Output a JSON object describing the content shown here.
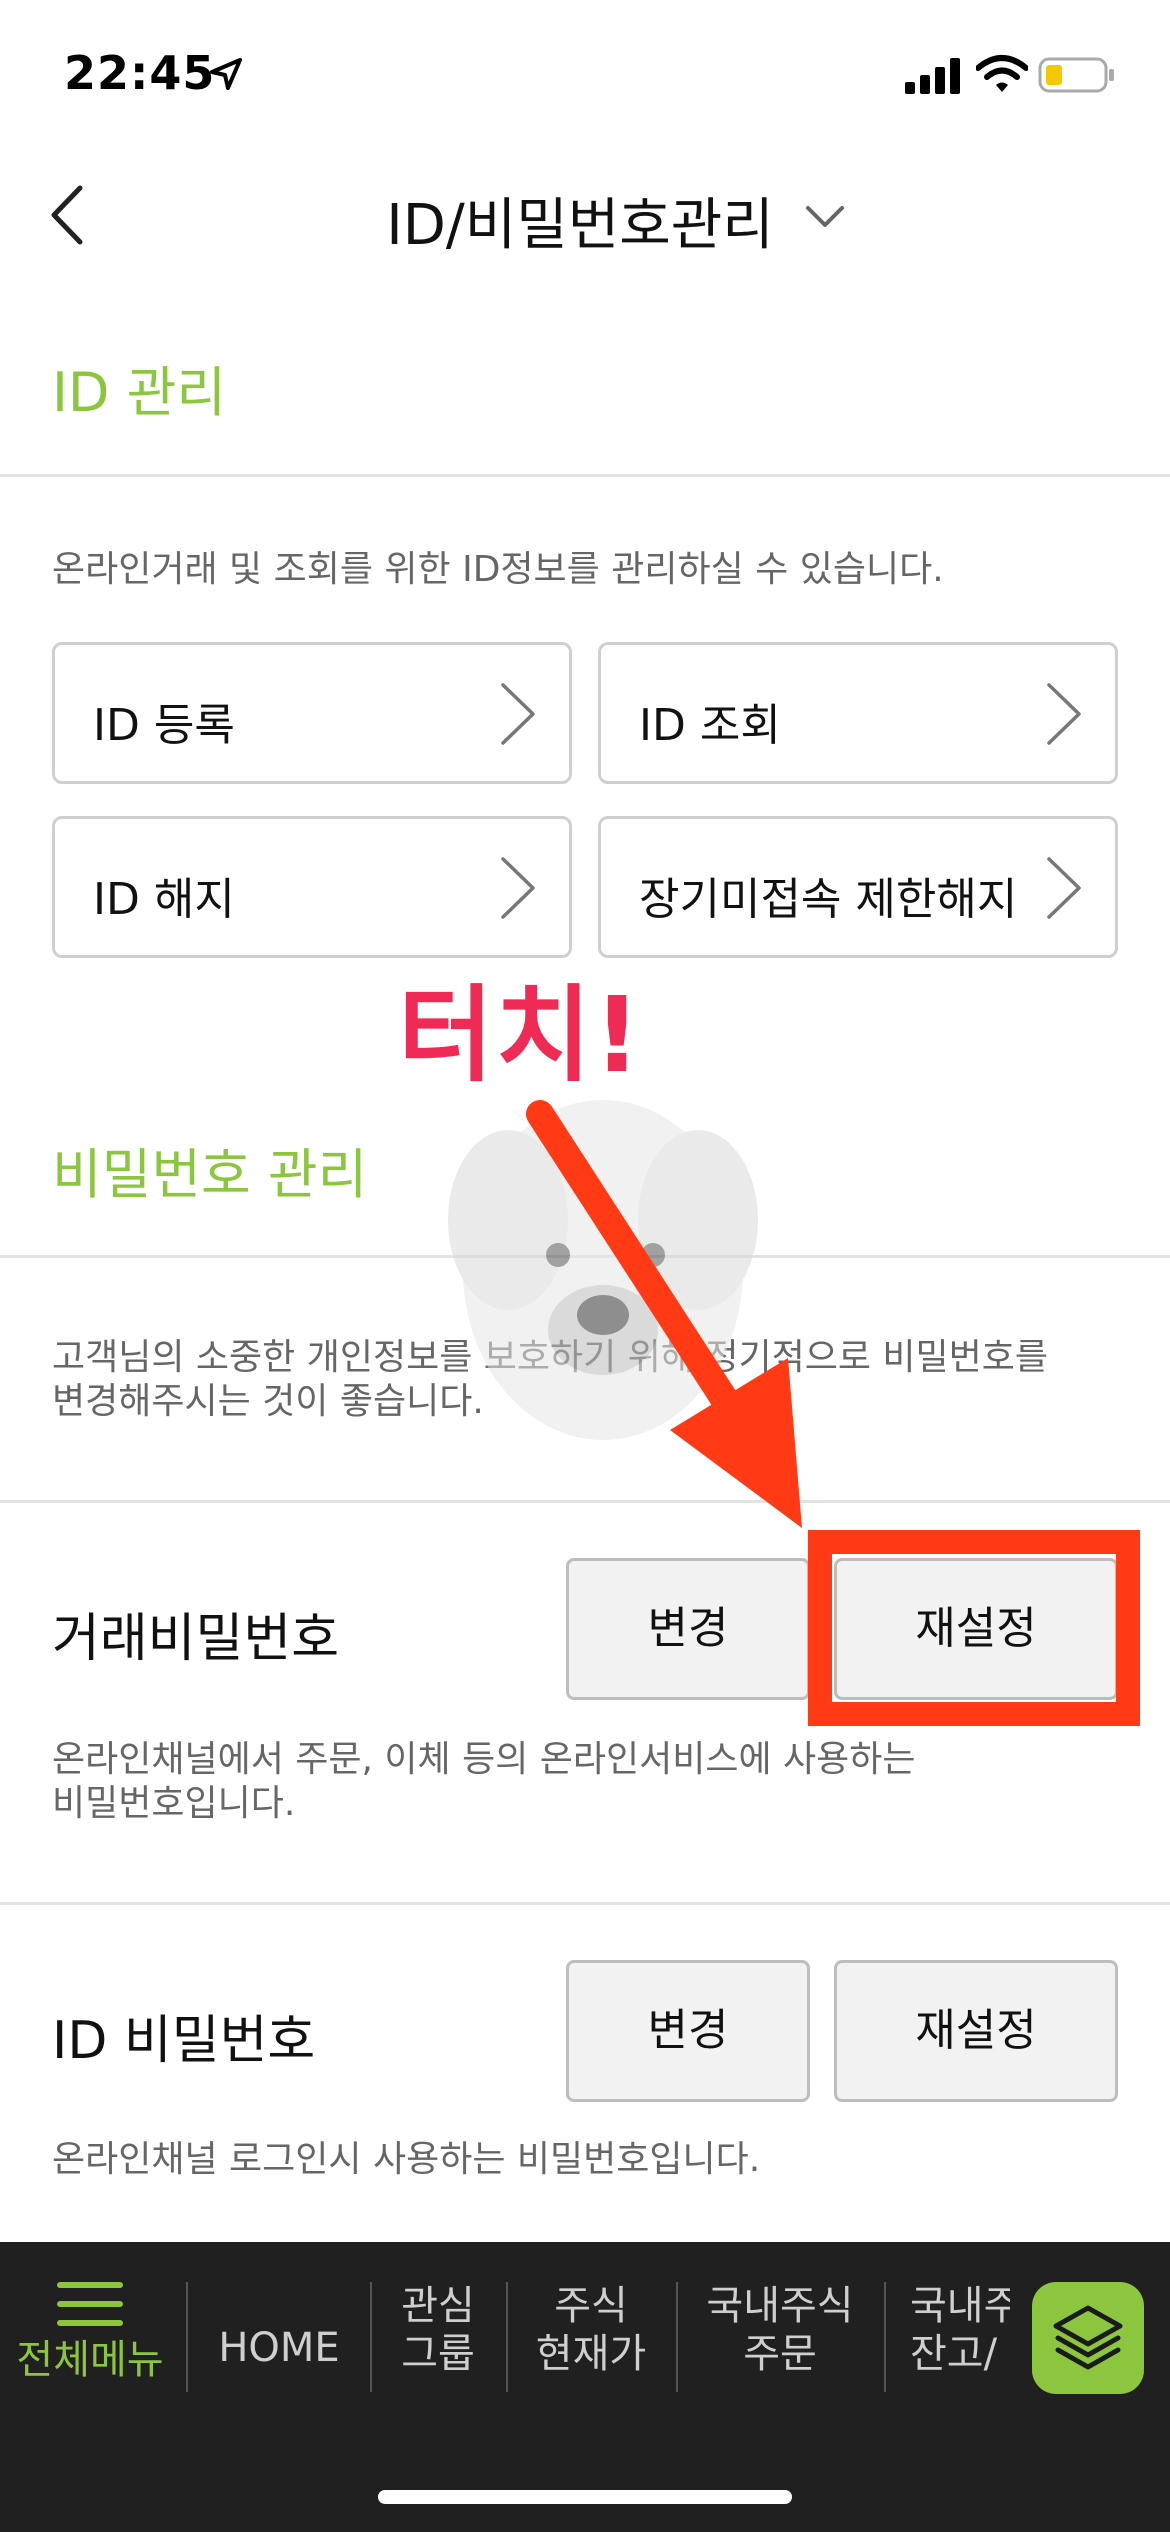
{
  "status_bar": {
    "time": "22:45",
    "icons": [
      "location-arrow-icon",
      "cellular-signal-icon",
      "wifi-icon",
      "battery-low-icon"
    ],
    "battery_color": "#f5c800"
  },
  "header": {
    "title": "ID/비밀번호관리",
    "back_icon": "chevron-left-icon",
    "dropdown_icon": "chevron-down-icon"
  },
  "id_section": {
    "title": "ID 관리",
    "description": "온라인거래 및 조회를 위한 ID정보를 관리하실 수 있습니다.",
    "buttons": [
      {
        "label": "ID 등록"
      },
      {
        "label": "ID 조회"
      },
      {
        "label": "ID 해지"
      },
      {
        "label": "장기미접속 제한해지"
      }
    ]
  },
  "password_section": {
    "title": "비밀번호 관리",
    "description_line1": "고객님의 소중한 개인정보를 보호하기 위해 정기적으로 비밀번호를",
    "description_line2": "변경해주시는 것이 좋습니다.",
    "trade_password": {
      "label": "거래비밀번호",
      "change_label": "변경",
      "reset_label": "재설정",
      "note_line1": "온라인채널에서 주문, 이체 등의 온라인서비스에 사용하는",
      "note_line2": "비밀번호입니다."
    },
    "id_password": {
      "label": "ID 비밀번호",
      "change_label": "변경",
      "reset_label": "재설정",
      "note": "온라인채널 로그인시 사용하는 비밀번호입니다."
    }
  },
  "annotation": {
    "text": "터치!",
    "text_color": "#ee2a55",
    "arrow_color": "#ff3a14",
    "highlight_color": "#ff3a14"
  },
  "tab_bar": {
    "menu": {
      "label": "전체메뉴",
      "icon": "hamburger-menu-icon"
    },
    "tabs": [
      {
        "line1": "HOME",
        "line2": ""
      },
      {
        "line1": "관심",
        "line2": "그룹"
      },
      {
        "line1": "주식",
        "line2": "현재가"
      },
      {
        "line1": "국내주식",
        "line2": "주문"
      },
      {
        "line1": "국내주",
        "line2": "잔고/"
      }
    ],
    "layers_icon": "layers-icon"
  },
  "colors": {
    "accent_green": "#8cc63f",
    "tab_bar_bg": "#202020"
  }
}
